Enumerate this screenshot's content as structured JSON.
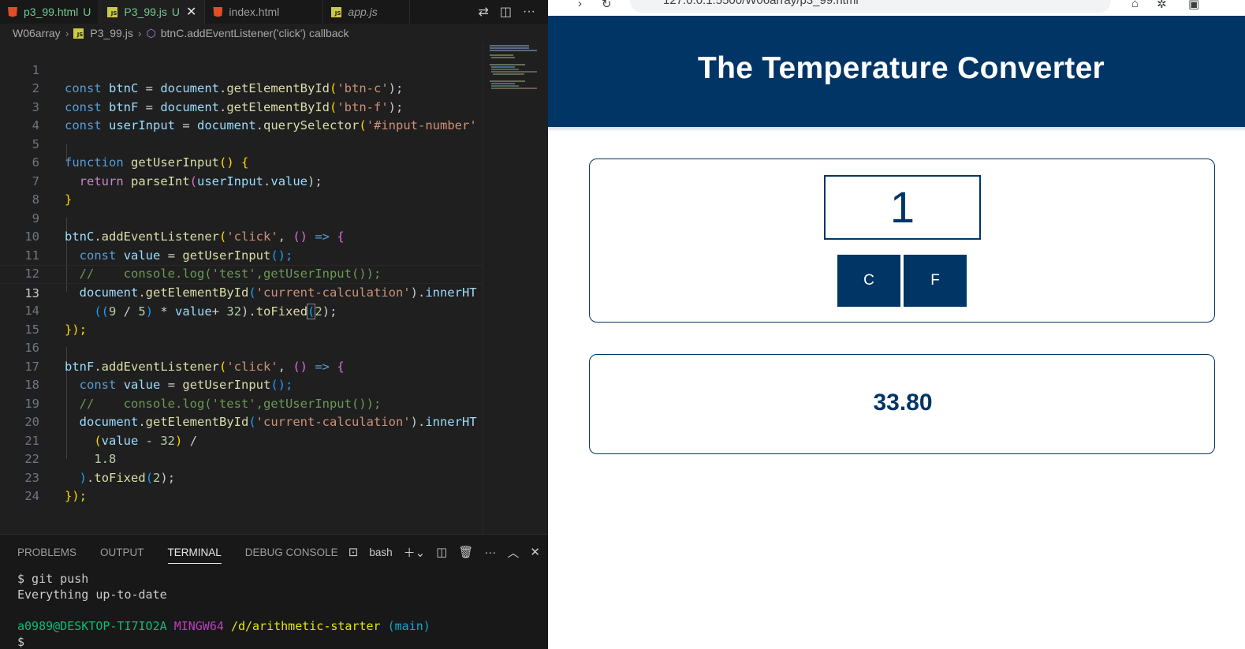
{
  "vscode": {
    "tabs": [
      {
        "label": "p3_99.html",
        "badge": "U",
        "icon": "html-file-icon"
      },
      {
        "label": "P3_99.js",
        "badge": "U",
        "icon": "js-file-icon",
        "active": true
      },
      {
        "label": "index.html",
        "badge": "",
        "icon": "html-file-icon"
      },
      {
        "label": "app.js",
        "badge": "",
        "icon": "js-file-icon"
      }
    ],
    "breadcrumb": {
      "folder": "W06array",
      "file": "P3_99.js",
      "symbol": "btnC.addEventListener('click') callback"
    },
    "line_numbers": [
      "1",
      "2",
      "3",
      "4",
      "5",
      "6",
      "7",
      "8",
      "9",
      "10",
      "11",
      "12",
      "13",
      "14",
      "15",
      "16",
      "17",
      "18",
      "19",
      "20",
      "21",
      "22",
      "23",
      "24"
    ],
    "current_line": 13,
    "code": {
      "l1": [
        "const",
        "btnC",
        " = ",
        "document",
        ".",
        "getElementById",
        "(",
        "'btn-c'",
        ");"
      ],
      "l2": [
        "const",
        "btnF",
        " = ",
        "document",
        ".",
        "getElementById",
        "(",
        "'btn-f'",
        ");"
      ],
      "l3": [
        "const",
        "userInput",
        " = ",
        "document",
        ".",
        "querySelector",
        "(",
        "'#input-number'"
      ],
      "l5": [
        "function",
        "getUserInput",
        "() {"
      ],
      "l6": [
        "return",
        "parseInt",
        "(",
        "userInput",
        ".",
        "value",
        ");"
      ],
      "l7": [
        "}"
      ],
      "l9": [
        "btnC",
        ".",
        "addEventListener",
        "(",
        "'click'",
        ", ",
        "()",
        " => ",
        "{"
      ],
      "l10": [
        "const",
        "value",
        " = ",
        "getUserInput",
        "();"
      ],
      "l11": [
        "//    console.log('test',getUserInput());"
      ],
      "l12": [
        "document",
        ".",
        "getElementById",
        "(",
        "'current-calculation'",
        ").",
        "innerHT"
      ],
      "l13": [
        "((",
        "9",
        " / ",
        "5",
        ")",
        " * ",
        "value",
        "+ ",
        "32",
        ").",
        "toFixed",
        "(",
        "2",
        ");"
      ],
      "l14": [
        "});"
      ],
      "l16": [
        "btnF",
        ".",
        "addEventListener",
        "(",
        "'click'",
        ", ",
        "()",
        " => ",
        "{"
      ],
      "l17": [
        "const",
        "value",
        " = ",
        "getUserInput",
        "();"
      ],
      "l18": [
        "//    console.log('test',getUserInput());"
      ],
      "l19": [
        "document",
        ".",
        "getElementById",
        "(",
        "'current-calculation'",
        ").",
        "innerHT"
      ],
      "l20": [
        "(",
        "value",
        " - ",
        "32",
        ")",
        " /"
      ],
      "l21": [
        "1.8"
      ],
      "l22": [
        ")",
        ".",
        "toFixed",
        "(",
        "2",
        ");"
      ],
      "l23": [
        "});"
      ]
    },
    "panel": {
      "tabs": [
        "PROBLEMS",
        "OUTPUT",
        "TERMINAL",
        "DEBUG CONSOLE"
      ],
      "active_tab": "TERMINAL",
      "shell": "bash"
    },
    "terminal": {
      "cmd": "$ git push",
      "output": "Everything up-to-date",
      "user": "a0989@DESKTOP-TI7IO2A",
      "env": "MINGW64",
      "path": "/d/arithmetic-starter",
      "branch": "(main)",
      "prompt": "$"
    }
  },
  "browser": {
    "url": "127.0.0.1:5500/W06array/p3_99.html",
    "title": "The Temperature Converter",
    "input_value": "1",
    "btn_c": "C",
    "btn_f": "F",
    "result": "33.80",
    "colors": {
      "primary": "#003566",
      "background": "#ffffff"
    }
  }
}
